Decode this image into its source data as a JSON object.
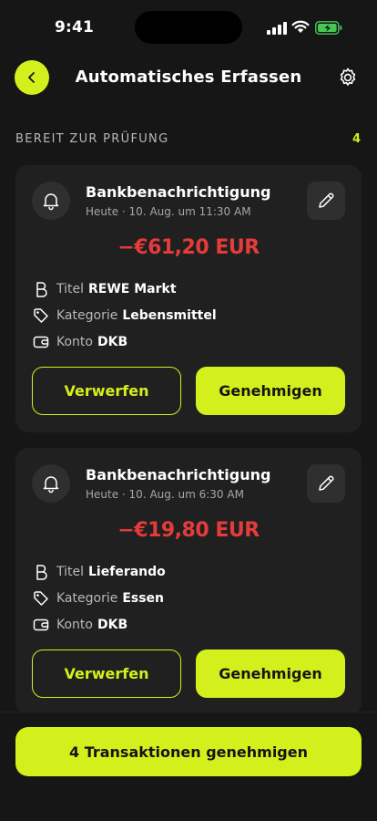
{
  "status_bar": {
    "time": "9:41",
    "icons": [
      "signal-icon",
      "wifi-icon",
      "battery-charging-icon"
    ]
  },
  "header": {
    "title": "Automatisches Erfassen",
    "back_icon": "chevron-left-icon",
    "settings_icon": "gear-icon"
  },
  "section": {
    "label": "BEREIT ZUR PRÜFUNG",
    "count": "4"
  },
  "cards": [
    {
      "title": "Bankbenachrichtigung",
      "subtitle": "Heute · 10. Aug. um 11:30 AM",
      "amount": "−€61,20 EUR",
      "fields": [
        {
          "icon": "b-letter-icon",
          "label": "Titel",
          "value": "REWE Markt"
        },
        {
          "icon": "tag-icon",
          "label": "Kategorie",
          "value": "Lebensmittel"
        },
        {
          "icon": "wallet-icon",
          "label": "Konto",
          "value": "DKB"
        }
      ],
      "reject_label": "Verwerfen",
      "approve_label": "Genehmigen"
    },
    {
      "title": "Bankbenachrichtigung",
      "subtitle": "Heute · 10. Aug. um 6:30 AM",
      "amount": "−€19,80 EUR",
      "fields": [
        {
          "icon": "b-letter-icon",
          "label": "Titel",
          "value": "Lieferando"
        },
        {
          "icon": "tag-icon",
          "label": "Kategorie",
          "value": "Essen"
        },
        {
          "icon": "wallet-icon",
          "label": "Konto",
          "value": "DKB"
        }
      ],
      "reject_label": "Verwerfen",
      "approve_label": "Genehmigen"
    }
  ],
  "bottom": {
    "approve_all_label": "4 Transaktionen genehmigen"
  },
  "colors": {
    "accent": "#d4f01c",
    "negative": "#e53b3b",
    "background": "#161616",
    "card": "#202020"
  }
}
